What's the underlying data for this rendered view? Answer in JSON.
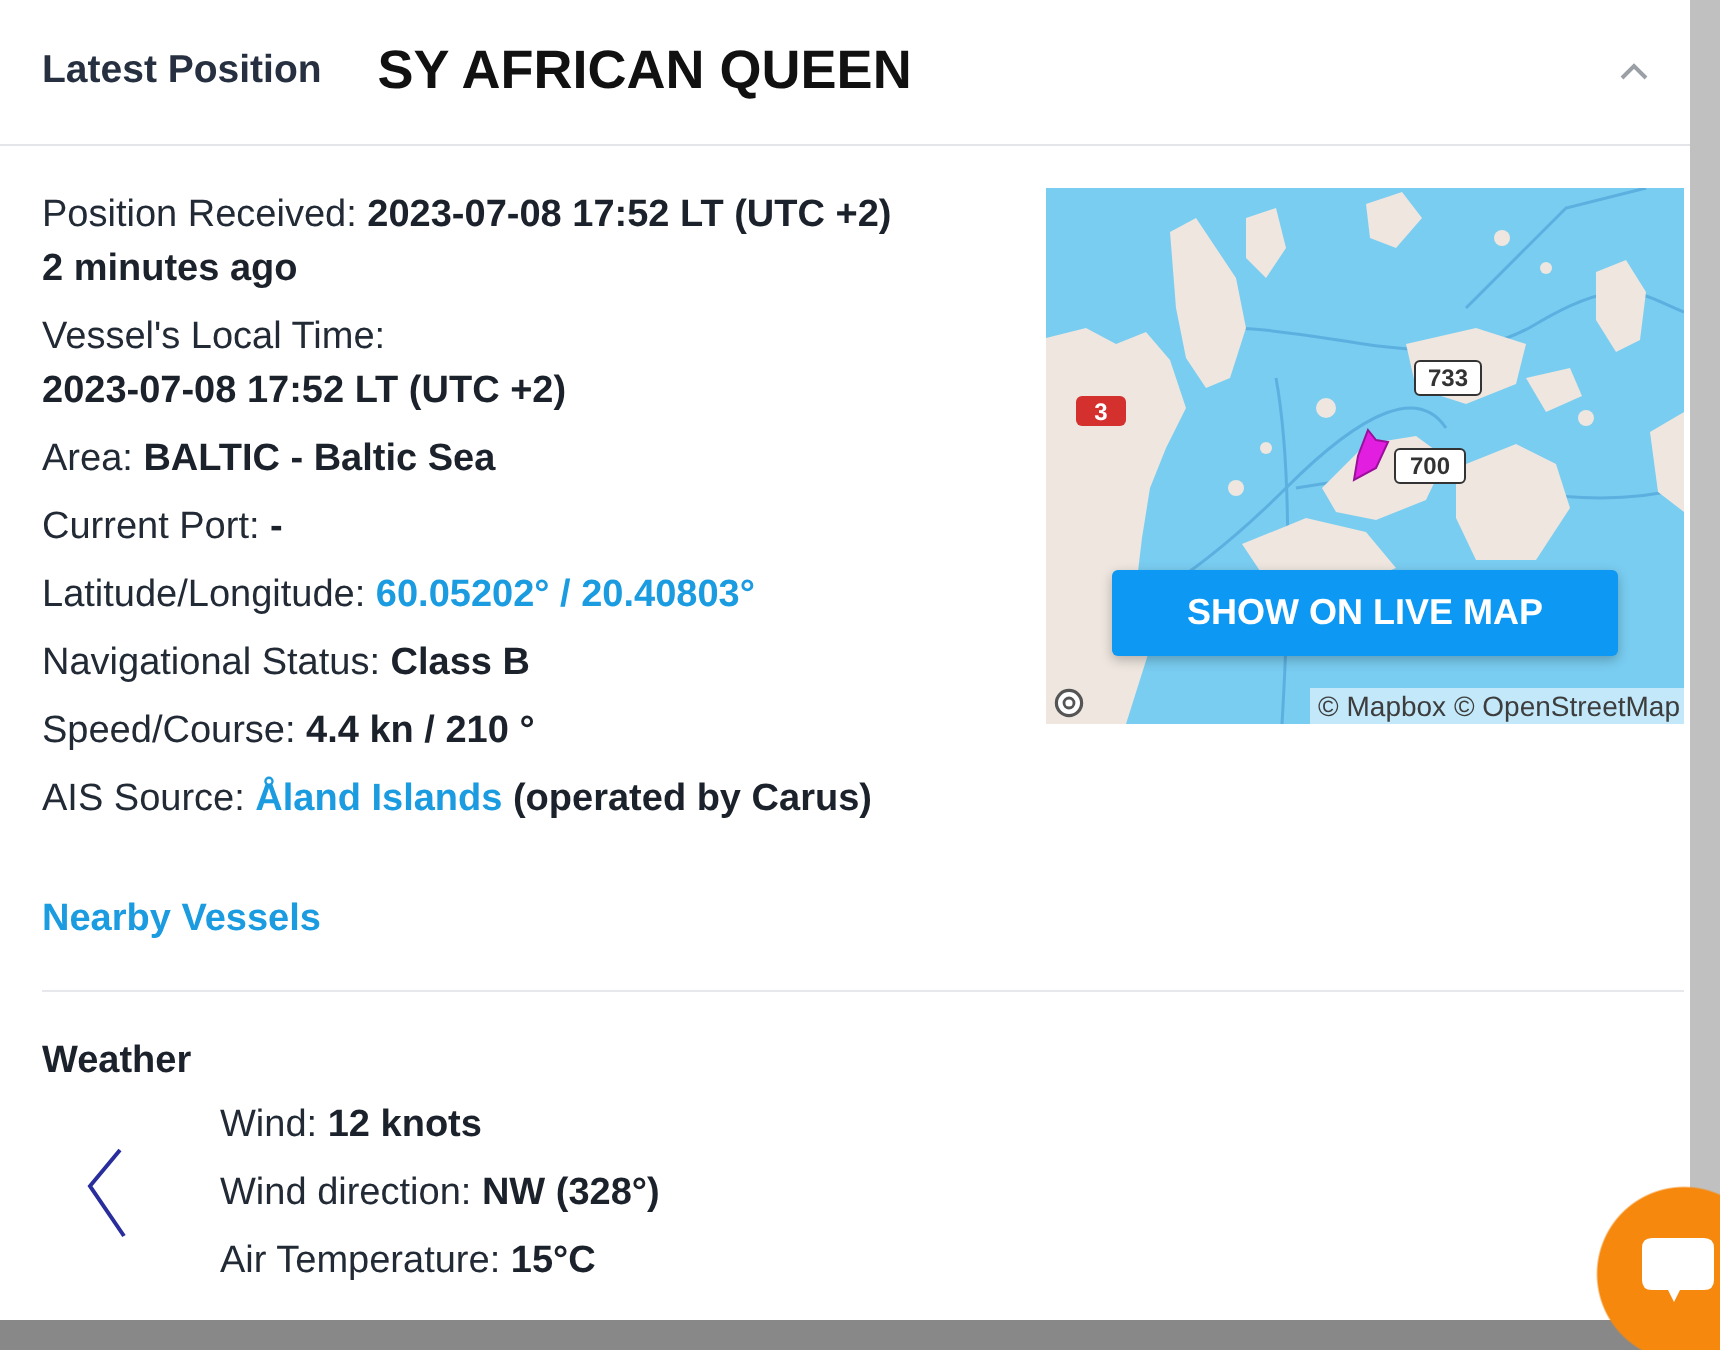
{
  "header": {
    "title": "Latest Position",
    "vessel_name": "SY AFRICAN QUEEN",
    "expanded": true
  },
  "details": [
    {
      "kind": "text",
      "text": "Position Received: **2023-07-08 17:52 LT (UTC +2)**",
      "note": "2 minutes ago"
    },
    {
      "kind": "stacked",
      "text": "Vessel's Local Time: **2023-07-08 17:52 LT (UTC +2)**"
    },
    {
      "kind": "text",
      "text": "Area: **BALTIC - Baltic Sea**"
    },
    {
      "kind": "text",
      "text": "Current Port: **-**"
    },
    {
      "kind": "link",
      "label": "Latitude/Longitude:",
      "link_text": "60.05202° / 20.40803°"
    },
    {
      "kind": "text",
      "text": "Navigational Status: **Class B**"
    },
    {
      "kind": "text",
      "text": "Speed/Course: **4.4 kn / 210 °**"
    },
    {
      "kind": "link",
      "label": "AIS Source:",
      "link_text": "Åland Islands",
      "suffix": "(operated by Carus)"
    }
  ],
  "map": {
    "road_labels": [
      {
        "text": "3",
        "color": "#d4302d"
      },
      {
        "text": "733",
        "color": "#ffffff"
      },
      {
        "text": "700",
        "color": "#ffffff"
      }
    ],
    "button": "SHOW ON LIVE MAP",
    "attribution": "© Mapbox © OpenStreetMap"
  },
  "nearby_link": "Nearby Vessels",
  "weather": {
    "title": "Weather",
    "rows": [
      {
        "label": "Wind:",
        "value": "12 knots"
      },
      {
        "label": "Wind direction:",
        "value": "NW (328°)"
      },
      {
        "label": "Air Temperature:",
        "value": "15°C"
      }
    ]
  }
}
